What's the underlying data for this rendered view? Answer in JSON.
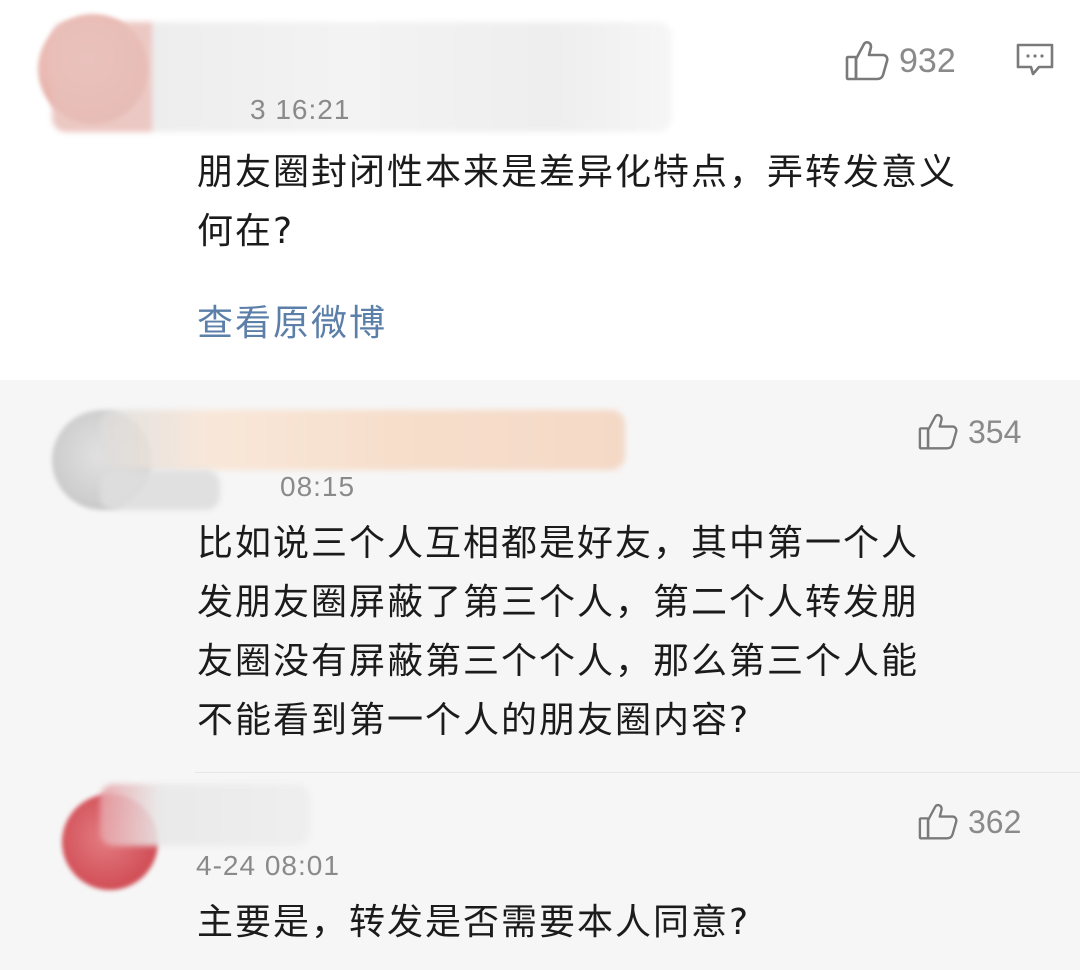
{
  "main_comment": {
    "time": "3 16:21",
    "content_lines": [
      "朋友圈封闭性本来是差异化特点，弄转发意义",
      "何在?"
    ],
    "likes": "932",
    "view_original_label": "查看原微博"
  },
  "replies": [
    {
      "time": "08:15",
      "content_lines": [
        "比如说三个人互相都是好友，其中第一个人",
        "发朋友圈屏蔽了第三个人，第二个人转发朋",
        "友圈没有屏蔽第三个个人，那么第三个人能",
        "不能看到第一个人的朋友圈内容?"
      ],
      "likes": "354"
    },
    {
      "time": "4-24 08:01",
      "content_lines": [
        "主要是，转发是否需要本人同意?"
      ],
      "likes": "362"
    }
  ],
  "icons": {
    "like": "thumbs-up-icon",
    "comment": "comment-bubble-icon"
  },
  "colors": {
    "link": "#5b7fa8",
    "meta_gray": "#8a8a8a",
    "reply_bg": "#f6f6f6"
  }
}
